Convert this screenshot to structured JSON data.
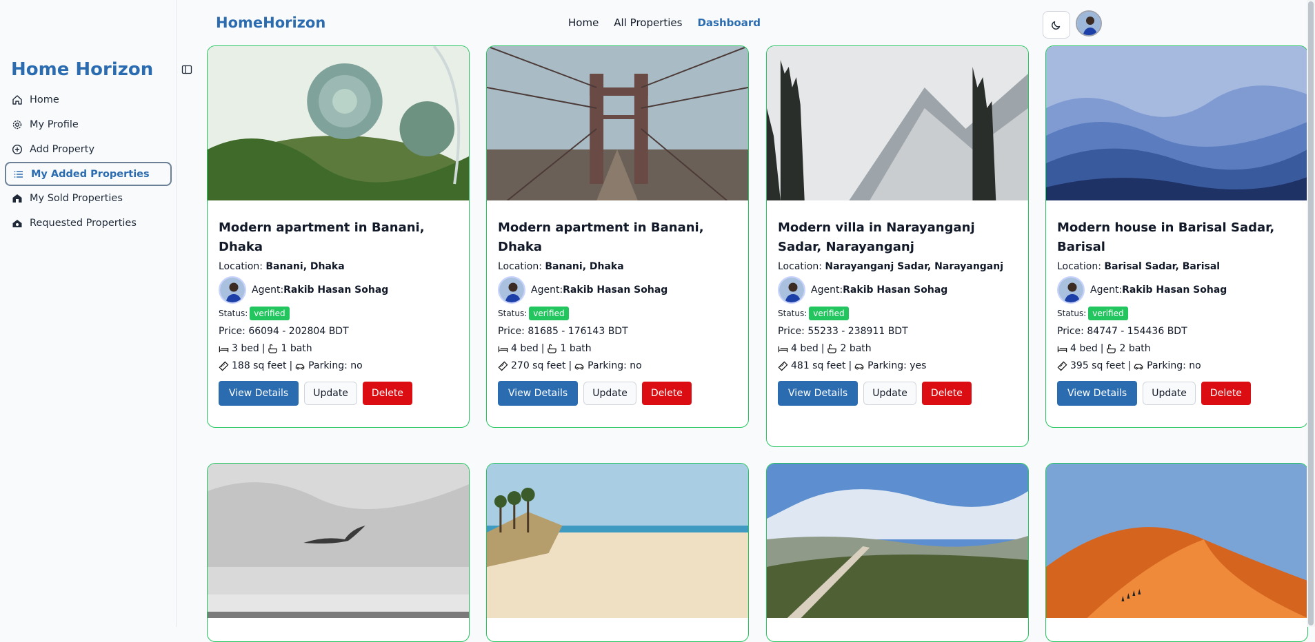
{
  "sidebar": {
    "brand": "Home Horizon",
    "items": [
      {
        "label": "Home",
        "icon": "home-icon"
      },
      {
        "label": "My Profile",
        "icon": "gear-icon"
      },
      {
        "label": "Add Property",
        "icon": "plus-circle-icon"
      },
      {
        "label": "My Added Properties",
        "icon": "list-icon",
        "active": true
      },
      {
        "label": "My Sold Properties",
        "icon": "sold-icon"
      },
      {
        "label": "Requested Properties",
        "icon": "request-icon"
      }
    ]
  },
  "topbar": {
    "logo": "HomeHorizon",
    "nav": [
      "Home",
      "All Properties",
      "Dashboard"
    ],
    "active_nav": "Dashboard"
  },
  "cards": [
    {
      "title": "Modern apartment in Banani, Dhaka",
      "location_label": "Location:",
      "location": "Banani, Dhaka",
      "agent_label": "Agent:",
      "agent": "Rakib Hasan Sohag",
      "status_label": "Status:",
      "status": "verified",
      "price": "Price: 66094 - 202804 BDT",
      "beds": "3 bed",
      "baths": "1 bath",
      "area": "188 sq feet",
      "parking": "Parking: no",
      "view": "View Details",
      "update": "Update",
      "delete": "Delete"
    },
    {
      "title": "Modern apartment in Banani, Dhaka",
      "location_label": "Location:",
      "location": "Banani, Dhaka",
      "agent_label": "Agent:",
      "agent": "Rakib Hasan Sohag",
      "status_label": "Status:",
      "status": "verified",
      "price": "Price: 81685 - 176143 BDT",
      "beds": "4 bed",
      "baths": "1 bath",
      "area": "270 sq feet",
      "parking": "Parking: no",
      "view": "View Details",
      "update": "Update",
      "delete": "Delete"
    },
    {
      "title": "Modern villa in Narayanganj Sadar, Narayanganj",
      "location_label": "Location:",
      "location": "Narayanganj Sadar, Narayanganj",
      "agent_label": "Agent:",
      "agent": "Rakib Hasan Sohag",
      "status_label": "Status:",
      "status": "verified",
      "price": "Price: 55233 - 238911 BDT",
      "beds": "4 bed",
      "baths": "2 bath",
      "area": "481 sq feet",
      "parking": "Parking: yes",
      "view": "View Details",
      "update": "Update",
      "delete": "Delete"
    },
    {
      "title": "Modern house in Barisal Sadar, Barisal",
      "location_label": "Location:",
      "location": "Barisal Sadar, Barisal",
      "agent_label": "Agent:",
      "agent": "Rakib Hasan Sohag",
      "status_label": "Status:",
      "status": "verified",
      "price": "Price: 84747 - 154436 BDT",
      "beds": "4 bed",
      "baths": "2 bath",
      "area": "395 sq feet",
      "parking": "Parking: no",
      "view": "View Details",
      "update": "Update",
      "delete": "Delete"
    }
  ],
  "colors": {
    "accent": "#2b6cb0",
    "verified": "#22c55e",
    "delete": "#dc0d12",
    "card_border": "#22c55e"
  }
}
